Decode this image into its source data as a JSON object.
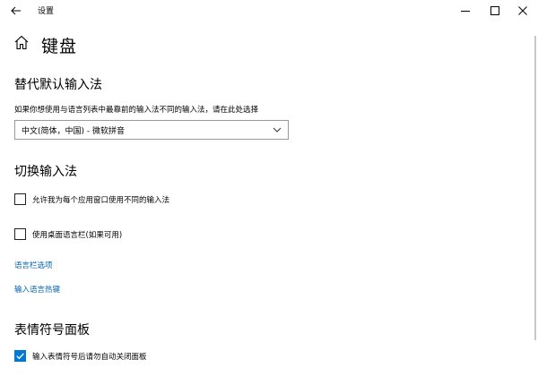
{
  "window": {
    "title": "设置"
  },
  "page": {
    "title": "键盘"
  },
  "default_input": {
    "heading": "替代默认输入法",
    "description": "如果你想使用与语言列表中最靠前的输入法不同的输入法，请在此处选择",
    "dropdown_value": "中文(简体，中国) - 微软拼音"
  },
  "switch_input": {
    "heading": "切换输入法",
    "option1_label": "允许我为每个应用窗口使用不同的输入法",
    "option1_checked": false,
    "option2_label": "使用桌面语言栏(如果可用)",
    "option2_checked": false,
    "link1": "语言栏选项",
    "link2": "输入语言热键"
  },
  "emoji_panel": {
    "heading": "表情符号面板",
    "option_label": "输入表情符号后请勿自动关闭面板",
    "option_checked": true
  },
  "colors": {
    "accent": "#0078d7",
    "link": "#0063b1"
  }
}
